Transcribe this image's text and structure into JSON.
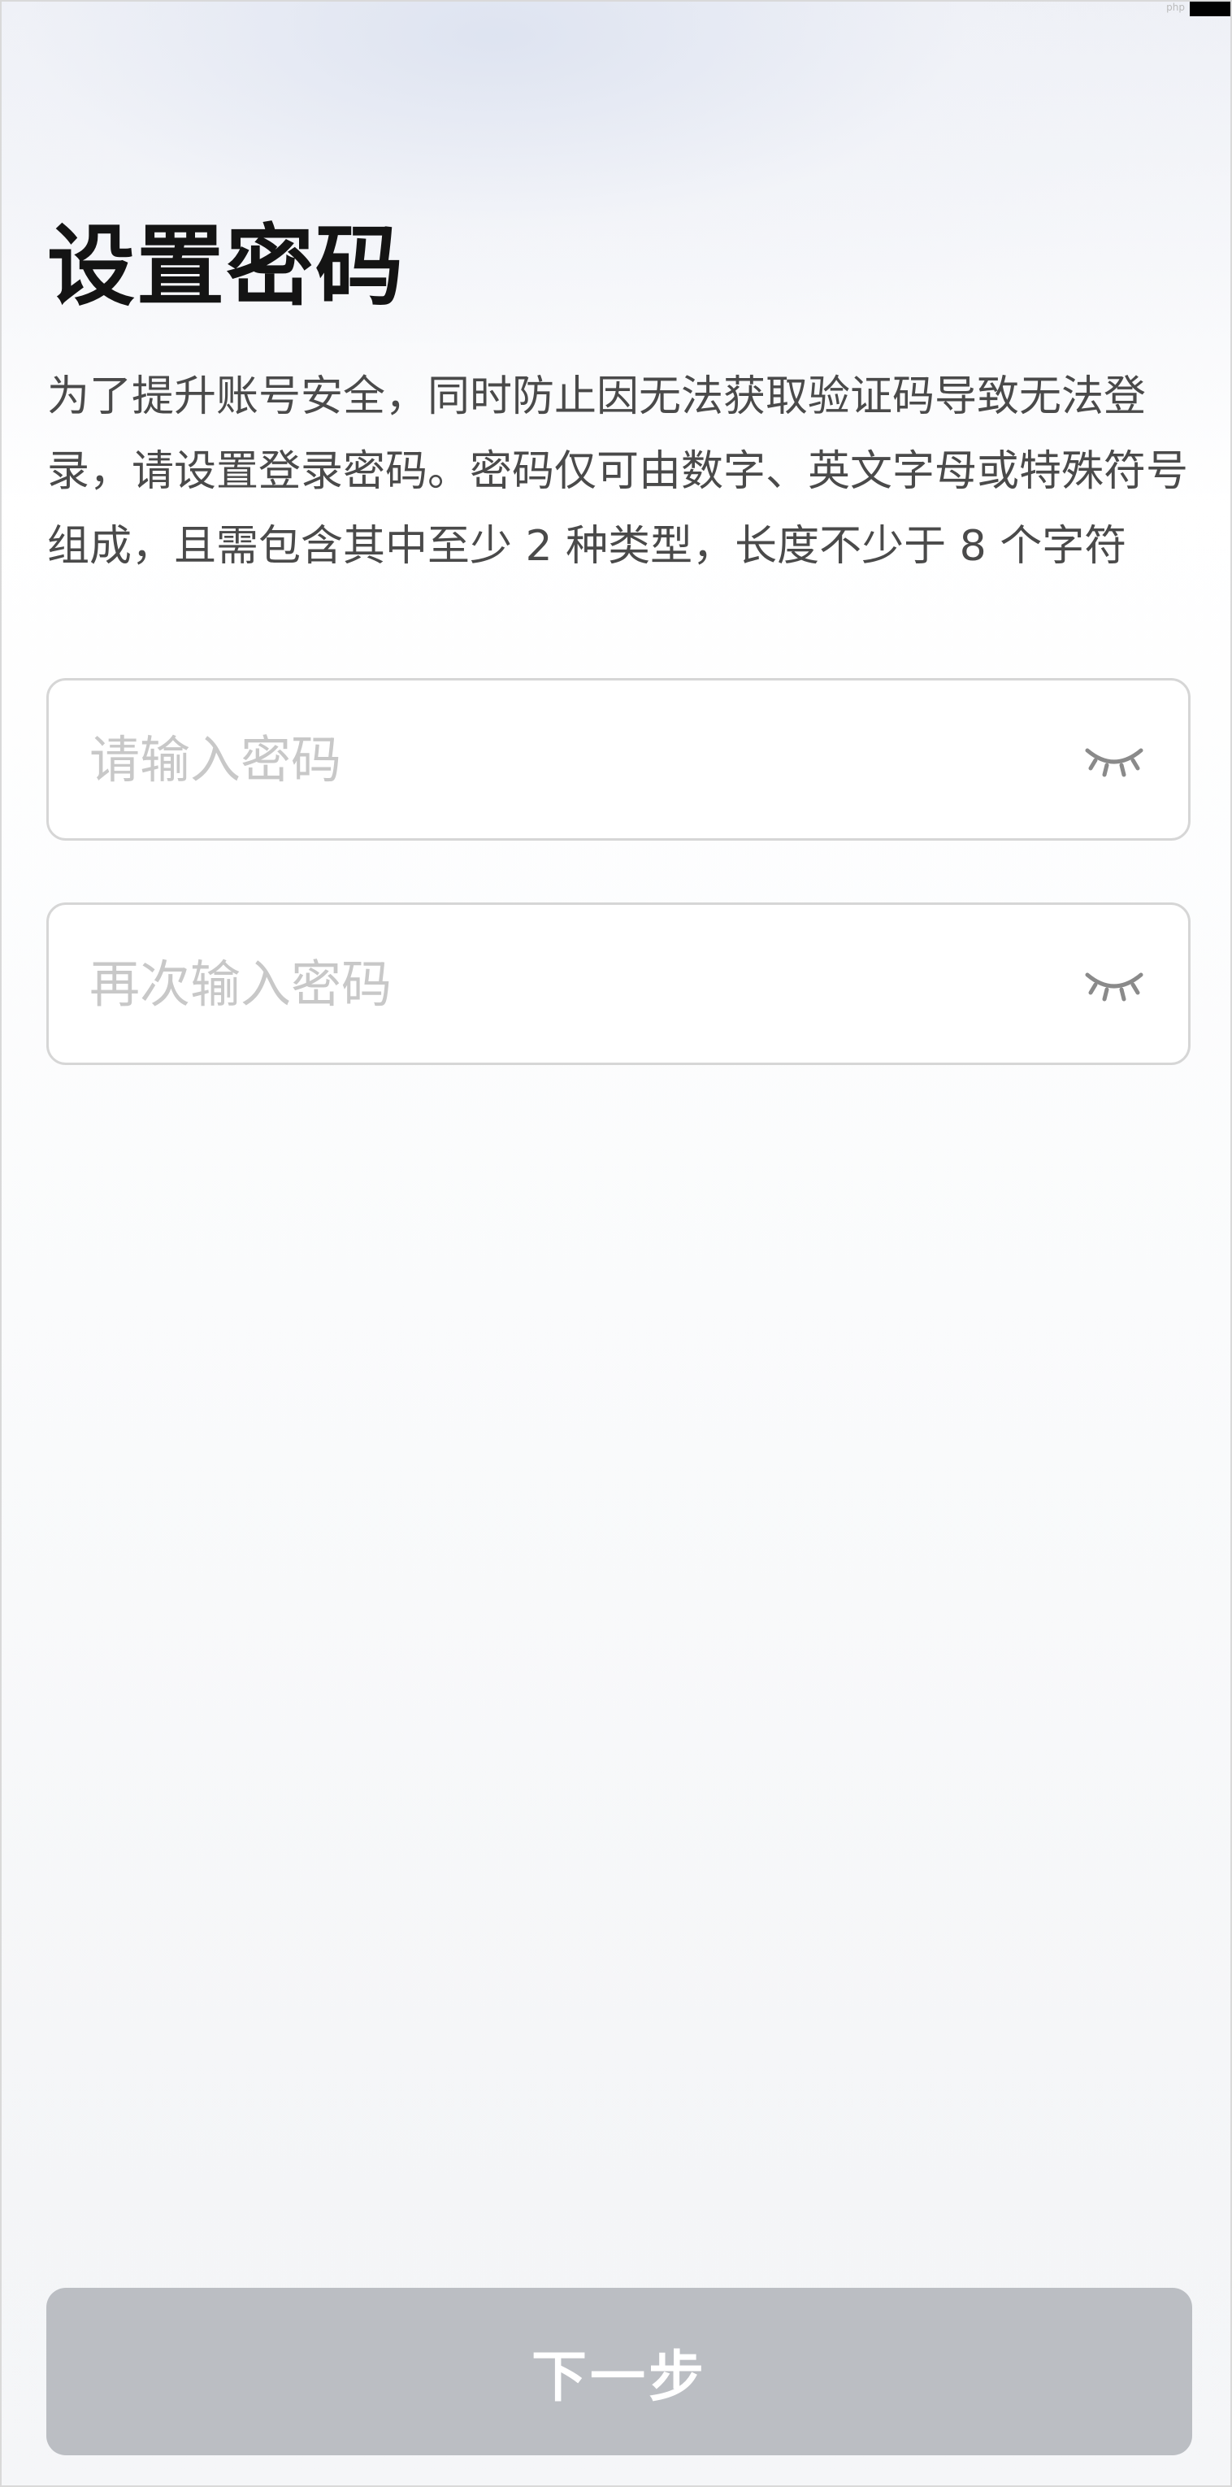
{
  "page": {
    "title": "设置密码",
    "description": "为了提升账号安全，同时防止因无法获取验证码导致无法登录，请设置登录密码。密码仅可由数字、英文字母或特殊符号组成，且需包含其中至少 2 种类型，长度不少于 8 个字符"
  },
  "form": {
    "password": {
      "value": "",
      "placeholder": "请输入密码",
      "toggle_icon": "eye-closed-icon"
    },
    "confirm_password": {
      "value": "",
      "placeholder": "再次输入密码",
      "toggle_icon": "eye-closed-icon"
    }
  },
  "actions": {
    "next_label": "下一步",
    "next_enabled": false
  },
  "colors": {
    "title": "#141414",
    "body_text": "#4a4a4a",
    "placeholder": "#c8c8c8",
    "field_border": "#d6d6d6",
    "button_disabled": "#bbbec3",
    "icon": "#8a8a8a"
  }
}
